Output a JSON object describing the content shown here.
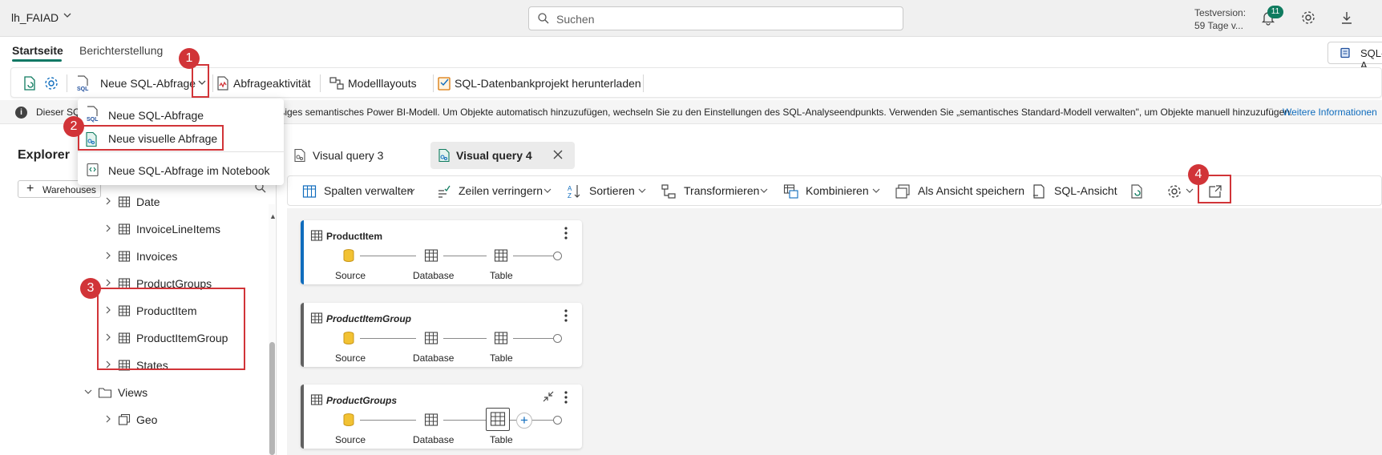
{
  "topbar": {
    "workspace": "lh_FAIAD",
    "search_placeholder": "Suchen",
    "trial_line1": "Testversion:",
    "trial_line2": "59 Tage v...",
    "notification_count": "11"
  },
  "ribbon": {
    "tabs": [
      "Startseite",
      "Berichterstellung"
    ],
    "sql_chip": "SQL-A",
    "toolbar": {
      "new_sql_query": "Neue SQL-Abfrage",
      "query_activity": "Abfrageaktivität",
      "model_layouts": "Modelllayouts",
      "download_project": "SQL-Datenbankprojekt herunterladen"
    }
  },
  "dropdown": {
    "items": [
      "Neue SQL-Abfrage",
      "Neue visuelle Abfrage",
      "Neue SQL-Abfrage im Notebook"
    ]
  },
  "infobar": {
    "start": "Dieser SQ",
    "text": "ßiges semantisches Power BI-Modell. Um Objekte automatisch hinzuzufügen, wechseln Sie zu den Einstellungen des SQL-Analyseendpunkts. Verwenden Sie „semantisches Standard-Modell verwalten\", um Objekte manuell hinzuzufügen.",
    "link": "Weitere Informationen"
  },
  "explorer": {
    "title": "Explorer",
    "warehouses_button": "Warehouses",
    "tables": [
      "Date",
      "InvoiceLineItems",
      "Invoices",
      "ProductGroups",
      "ProductItem",
      "ProductItemGroup",
      "States"
    ],
    "views_folder": "Views",
    "views": [
      "Geo"
    ]
  },
  "query_tabs": [
    "Visual query 3",
    "Visual query 4"
  ],
  "vq_toolbar": {
    "manage_columns": "Spalten verwalten",
    "reduce_rows": "Zeilen verringern",
    "sort": "Sortieren",
    "transform": "Transformieren",
    "combine": "Kombinieren",
    "save_as_view": "Als Ansicht speichern",
    "sql_view": "SQL-Ansicht"
  },
  "cards": [
    {
      "title": "ProductItem",
      "steps": [
        "Source",
        "Database",
        "Table"
      ]
    },
    {
      "title": "ProductItemGroup",
      "steps": [
        "Source",
        "Database",
        "Table"
      ]
    },
    {
      "title": "ProductGroups",
      "steps": [
        "Source",
        "Database",
        "Table"
      ]
    }
  ],
  "callouts": [
    "1",
    "2",
    "3",
    "4"
  ],
  "colors": {
    "accent": "#117865",
    "callout": "#d13438",
    "link": "#0f6cbd",
    "active_card_bar": "#0f6cbd",
    "inactive_card_bar": "#616161"
  }
}
